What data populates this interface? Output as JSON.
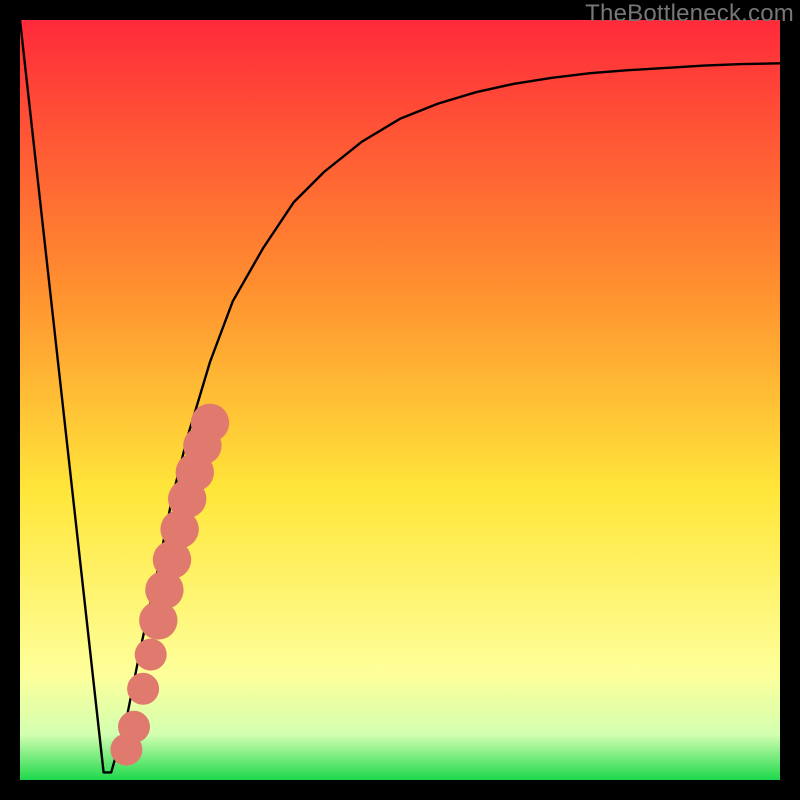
{
  "watermark": "TheBottleneck.com",
  "colors": {
    "frame": "#000000",
    "grad_top": "#ff2a3a",
    "grad_mid_upper": "#ff8f2f",
    "grad_mid": "#ffe63a",
    "grad_mid_lower": "#feff9a",
    "grad_near_bottom": "#d3ffb0",
    "grad_bottom": "#1ed84c",
    "curve": "#000000",
    "marker": "#e07a6e"
  },
  "chart_data": {
    "type": "line",
    "title": "",
    "xlabel": "",
    "ylabel": "",
    "xlim": [
      0,
      100
    ],
    "ylim": [
      0,
      100
    ],
    "series": [
      {
        "name": "bottleneck-curve",
        "x": [
          0,
          2,
          4,
          6,
          8,
          10,
          11,
          12,
          14,
          16,
          18,
          20,
          22,
          25,
          28,
          32,
          36,
          40,
          45,
          50,
          55,
          60,
          65,
          70,
          75,
          80,
          85,
          90,
          95,
          100
        ],
        "values": [
          100,
          82,
          64,
          46,
          28,
          10,
          1,
          1,
          8,
          18,
          27,
          37,
          45,
          55,
          63,
          70,
          76,
          80,
          84,
          87,
          89,
          90.5,
          91.6,
          92.4,
          93,
          93.4,
          93.7,
          94,
          94.2,
          94.3
        ]
      }
    ],
    "markers": {
      "name": "highlighted-range",
      "points": [
        {
          "x": 14.0,
          "y": 4.0,
          "r": 1.5
        },
        {
          "x": 15.0,
          "y": 7.0,
          "r": 1.5
        },
        {
          "x": 16.2,
          "y": 12.0,
          "r": 1.5
        },
        {
          "x": 17.2,
          "y": 16.5,
          "r": 1.5
        },
        {
          "x": 18.2,
          "y": 21.0,
          "r": 1.8
        },
        {
          "x": 19.0,
          "y": 25.0,
          "r": 1.8
        },
        {
          "x": 20.0,
          "y": 29.0,
          "r": 1.8
        },
        {
          "x": 21.0,
          "y": 33.0,
          "r": 1.8
        },
        {
          "x": 22.0,
          "y": 37.0,
          "r": 1.8
        },
        {
          "x": 23.0,
          "y": 40.5,
          "r": 1.8
        },
        {
          "x": 24.0,
          "y": 44.0,
          "r": 1.8
        },
        {
          "x": 25.0,
          "y": 47.0,
          "r": 1.8
        }
      ]
    }
  }
}
